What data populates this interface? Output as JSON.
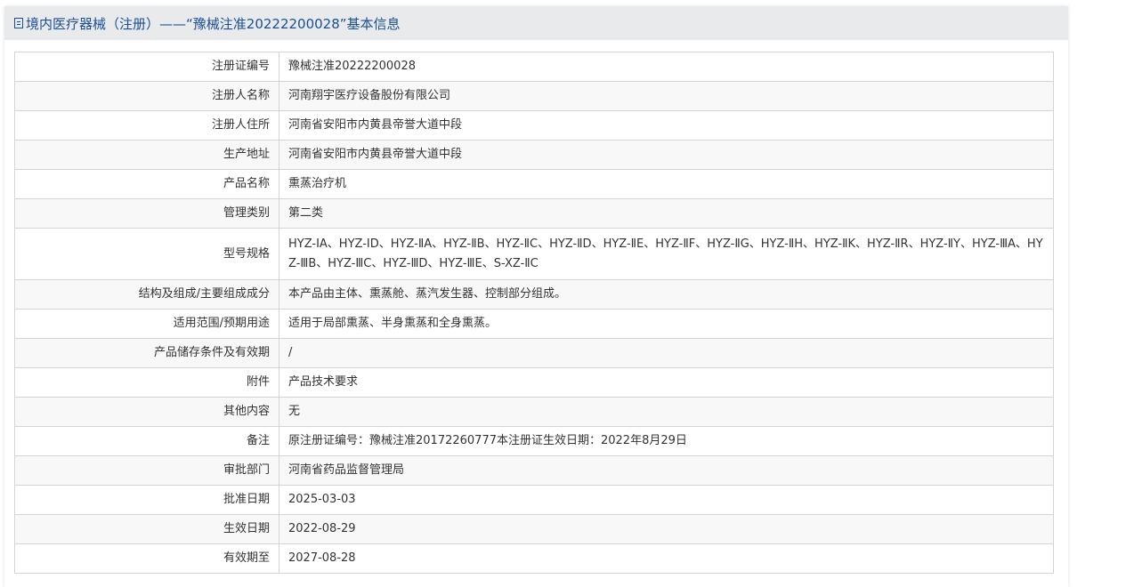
{
  "header": {
    "title": "境内医疗器械（注册）——“豫械注准20222200028”基本信息"
  },
  "rows": [
    {
      "label": "注册证编号",
      "value": "豫械注准20222200028"
    },
    {
      "label": "注册人名称",
      "value": "河南翔宇医疗设备股份有限公司"
    },
    {
      "label": "注册人住所",
      "value": "河南省安阳市内黄县帝誉大道中段"
    },
    {
      "label": "生产地址",
      "value": "河南省安阳市内黄县帝誉大道中段"
    },
    {
      "label": "产品名称",
      "value": "熏蒸治疗机"
    },
    {
      "label": "管理类别",
      "value": "第二类"
    },
    {
      "label": "型号规格",
      "value": "HYZ-ⅠA、HYZ-ⅠD、HYZ-ⅡA、HYZ-ⅡB、HYZ-ⅡC、HYZ-ⅡD、HYZ-ⅡE、HYZ-ⅡF、HYZ-ⅡG、HYZ-ⅡH、HYZ-ⅡK、HYZ-ⅡR、HYZ-ⅡY、HYZ-ⅢA、HYZ-ⅢB、HYZ-ⅢC、HYZ-ⅢD、HYZ-ⅢE、S-XZ-ⅡC"
    },
    {
      "label": "结构及组成/主要组成成分",
      "value": "本产品由主体、熏蒸舱、蒸汽发生器、控制部分组成。"
    },
    {
      "label": "适用范围/预期用途",
      "value": "适用于局部熏蒸、半身熏蒸和全身熏蒸。"
    },
    {
      "label": "产品储存条件及有效期",
      "value": "/"
    },
    {
      "label": "附件",
      "value": "产品技术要求"
    },
    {
      "label": "其他内容",
      "value": "无"
    },
    {
      "label": "备注",
      "value": "原注册证编号：豫械注准20172260777本注册证生效日期：2022年8月29日"
    },
    {
      "label": "审批部门",
      "value": "河南省药品监督管理局"
    },
    {
      "label": "批准日期",
      "value": "2025-03-03"
    },
    {
      "label": "生效日期",
      "value": "2022-08-29"
    },
    {
      "label": "有效期至",
      "value": "2027-08-28"
    }
  ]
}
